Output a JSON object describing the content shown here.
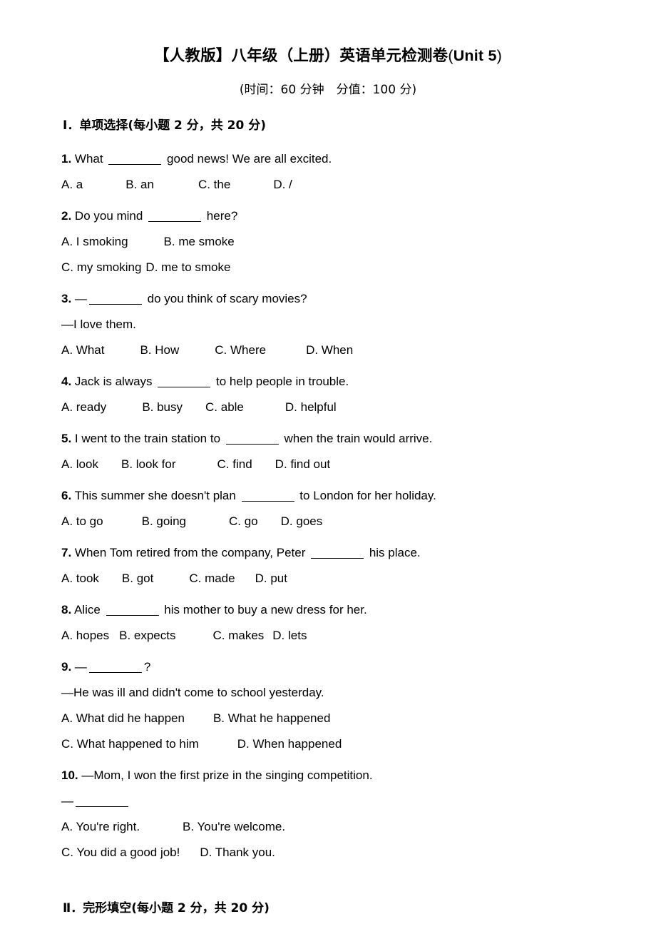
{
  "title": {
    "cjk_part": "【人教版】八年级（上册）英语单元检测卷",
    "open_paren": "(",
    "unit": "Unit 5",
    "close_paren": ")"
  },
  "subtitle": "(时间：60 分钟　分值：100 分)",
  "sections": [
    {
      "roman": "Ⅰ",
      "dot": "．",
      "heading": "单项选择(每小题 2 分，共 20 分)"
    },
    {
      "roman": "Ⅱ",
      "dot": "．",
      "heading": "完形填空(每小题 2 分，共 20 分)"
    }
  ],
  "questions": [
    {
      "num": "1.",
      "stem_before": " What ",
      "stem_after": " good news! We are all excited.",
      "extra_lines": [],
      "option_rows": [
        [
          "A. a",
          "B. an",
          "C. the",
          "D. /"
        ]
      ],
      "option_pads": [
        [
          0,
          60,
          62,
          60
        ]
      ]
    },
    {
      "num": "2.",
      "stem_before": " Do you mind ",
      "stem_after": " here?",
      "extra_lines": [],
      "option_rows": [
        [
          "A. I smoking",
          "B. me smoke"
        ],
        [
          "C. my smoking",
          "D. me to smoke"
        ]
      ],
      "option_pads": [
        [
          0,
          50
        ],
        [
          0,
          6
        ]
      ]
    },
    {
      "num": "3.",
      "stem_before": " —",
      "stem_after": " do you think of scary movies?",
      "extra_lines": [
        "—I love them."
      ],
      "option_rows": [
        [
          "A. What",
          "B. How",
          "C. Where",
          "D. When"
        ]
      ],
      "option_pads": [
        [
          0,
          50,
          50,
          56
        ]
      ]
    },
    {
      "num": "4.",
      "stem_before": " Jack is always ",
      "stem_after": " to help people in trouble.",
      "extra_lines": [],
      "option_rows": [
        [
          "A. ready",
          "B. busy",
          "C. able",
          "D. helpful"
        ]
      ],
      "option_pads": [
        [
          0,
          50,
          32,
          58
        ]
      ]
    },
    {
      "num": "5.",
      "stem_before": " I went to the train station to ",
      "stem_after": " when the train would arrive.",
      "extra_lines": [],
      "option_rows": [
        [
          "A. look",
          "B. look for",
          "C. find",
          "D. find out"
        ]
      ],
      "option_pads": [
        [
          0,
          32,
          58,
          32
        ]
      ]
    },
    {
      "num": "6.",
      "stem_before": " This summer she doesn't plan ",
      "stem_after": " to London for her holiday.",
      "extra_lines": [],
      "option_rows": [
        [
          "A. to go",
          "B. going",
          "C. go",
          "D. goes"
        ]
      ],
      "option_pads": [
        [
          0,
          54,
          60,
          32
        ]
      ]
    },
    {
      "num": "7.",
      "stem_before": " When Tom retired from the company, Peter ",
      "stem_after": " his place.",
      "extra_lines": [],
      "option_rows": [
        [
          "A. took",
          "B. got",
          "C. made",
          "D. put"
        ]
      ],
      "option_pads": [
        [
          0,
          32,
          50,
          28
        ]
      ]
    },
    {
      "num": "8.",
      "stem_before": " Alice ",
      "stem_after": " his mother to buy a new dress for her.",
      "extra_lines": [],
      "option_rows": [
        [
          "A. hopes",
          "B. expects",
          "C. makes",
          "D. lets"
        ]
      ],
      "option_pads": [
        [
          0,
          14,
          52,
          12
        ]
      ]
    },
    {
      "num": "9.",
      "stem_before": " —",
      "stem_after": "?",
      "extra_lines": [
        "—He was ill and didn't come to school yesterday."
      ],
      "option_rows": [
        [
          "A. What did he happen",
          "B. What he happened"
        ],
        [
          "C. What happened to him",
          "D. When happened"
        ]
      ],
      "option_pads": [
        [
          0,
          40
        ],
        [
          0,
          54
        ]
      ]
    },
    {
      "num": "10.",
      "stem_before": " —Mom, I won the first prize in the singing competition.",
      "stem_after": "",
      "no_blank": true,
      "extra_lines": [],
      "answer_dash_line": "—",
      "option_rows": [
        [
          "A. You're right.",
          "B. You're welcome."
        ],
        [
          "C. You did a good job!",
          "D. Thank you."
        ]
      ],
      "option_pads": [
        [
          0,
          60
        ],
        [
          0,
          28
        ]
      ]
    }
  ]
}
